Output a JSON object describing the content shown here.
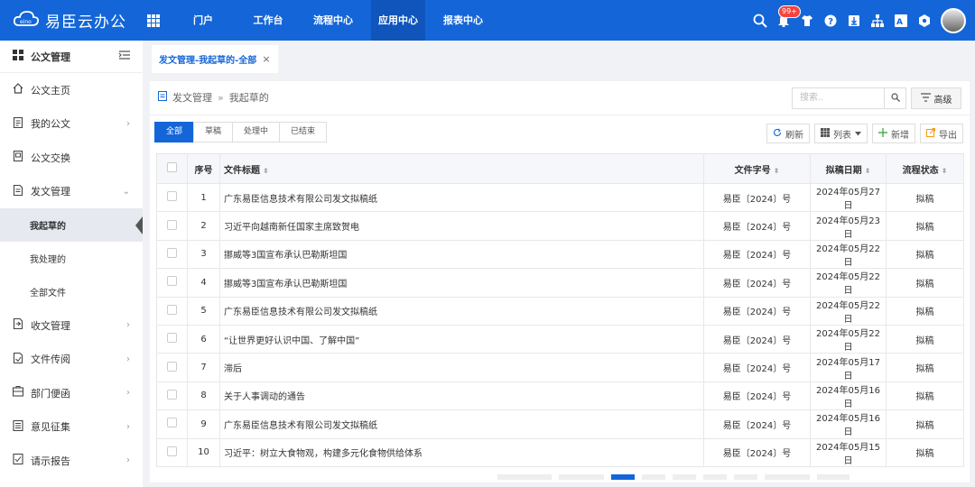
{
  "app": {
    "logo_text": "易臣云办公"
  },
  "nav": [
    {
      "label": "门户",
      "active": false
    },
    {
      "label": "工作台",
      "active": false
    },
    {
      "label": "流程中心",
      "active": false
    },
    {
      "label": "应用中心",
      "active": true
    },
    {
      "label": "报表中心",
      "active": false
    }
  ],
  "notifications": {
    "badge": "99+"
  },
  "sidebar": {
    "header": "公文管理",
    "items": [
      {
        "label": "公文主页",
        "icon": "home-icon",
        "arrow": ""
      },
      {
        "label": "我的公文",
        "icon": "document-icon",
        "arrow": "›"
      },
      {
        "label": "公文交换",
        "icon": "exchange-icon",
        "arrow": ""
      },
      {
        "label": "发文管理",
        "icon": "send-doc-icon",
        "arrow": "⌄"
      }
    ],
    "sub_items": [
      {
        "label": "我起草的",
        "active": true
      },
      {
        "label": "我处理的",
        "active": false
      },
      {
        "label": "全部文件",
        "active": false
      }
    ],
    "items2": [
      {
        "label": "收文管理",
        "icon": "receive-doc-icon",
        "arrow": "›"
      },
      {
        "label": "文件传阅",
        "icon": "circulate-icon",
        "arrow": "›"
      },
      {
        "label": "部门便函",
        "icon": "memo-icon",
        "arrow": "›"
      },
      {
        "label": "意见征集",
        "icon": "feedback-icon",
        "arrow": "›"
      },
      {
        "label": "请示报告",
        "icon": "report-icon",
        "arrow": "›"
      }
    ]
  },
  "tab": {
    "label": "发文管理-我起草的-全部",
    "close": "×"
  },
  "breadcrumb": {
    "root": "发文管理",
    "sep": "»",
    "current": "我起草的"
  },
  "search": {
    "placeholder": "搜索.."
  },
  "advanced": "高级",
  "filters": [
    {
      "label": "全部",
      "active": true
    },
    {
      "label": "草稿",
      "active": false
    },
    {
      "label": "处理中",
      "active": false
    },
    {
      "label": "已结束",
      "active": false
    }
  ],
  "tools": {
    "refresh": "刷新",
    "list": "列表",
    "add": "新增",
    "export": "导出"
  },
  "table": {
    "headers": {
      "seq": "序号",
      "title": "文件标题",
      "docno": "文件字号",
      "date": "拟稿日期",
      "status": "流程状态"
    },
    "rows": [
      {
        "seq": "1",
        "title": "广东易臣信息技术有限公司发文拟稿纸",
        "docno": "易臣〔2024〕号",
        "date": "2024年05月27日",
        "status": "拟稿"
      },
      {
        "seq": "2",
        "title": "习近平向越南新任国家主席致贺电",
        "docno": "易臣〔2024〕号",
        "date": "2024年05月23日",
        "status": "拟稿"
      },
      {
        "seq": "3",
        "title": "挪威等3国宣布承认巴勒斯坦国",
        "docno": "易臣〔2024〕号",
        "date": "2024年05月22日",
        "status": "拟稿"
      },
      {
        "seq": "4",
        "title": "挪威等3国宣布承认巴勒斯坦国",
        "docno": "易臣〔2024〕号",
        "date": "2024年05月22日",
        "status": "拟稿"
      },
      {
        "seq": "5",
        "title": "广东易臣信息技术有限公司发文拟稿纸",
        "docno": "易臣〔2024〕号",
        "date": "2024年05月22日",
        "status": "拟稿"
      },
      {
        "seq": "6",
        "title": "“让世界更好认识中国、了解中国”",
        "docno": "易臣〔2024〕号",
        "date": "2024年05月22日",
        "status": "拟稿"
      },
      {
        "seq": "7",
        "title": "滞后",
        "docno": "易臣〔2024〕号",
        "date": "2024年05月17日",
        "status": "拟稿"
      },
      {
        "seq": "8",
        "title": "关于人事调动的通告",
        "docno": "易臣〔2024〕号",
        "date": "2024年05月16日",
        "status": "拟稿"
      },
      {
        "seq": "9",
        "title": "广东易臣信息技术有限公司发文拟稿纸",
        "docno": "易臣〔2024〕号",
        "date": "2024年05月16日",
        "status": "拟稿"
      },
      {
        "seq": "10",
        "title": "习近平：树立大食物观，构建多元化食物供给体系",
        "docno": "易臣〔2024〕号",
        "date": "2024年05月15日",
        "status": "拟稿"
      }
    ]
  },
  "colors": {
    "primary": "#1466d8",
    "nav_active": "#0f55bb",
    "badge": "#f5443c"
  }
}
